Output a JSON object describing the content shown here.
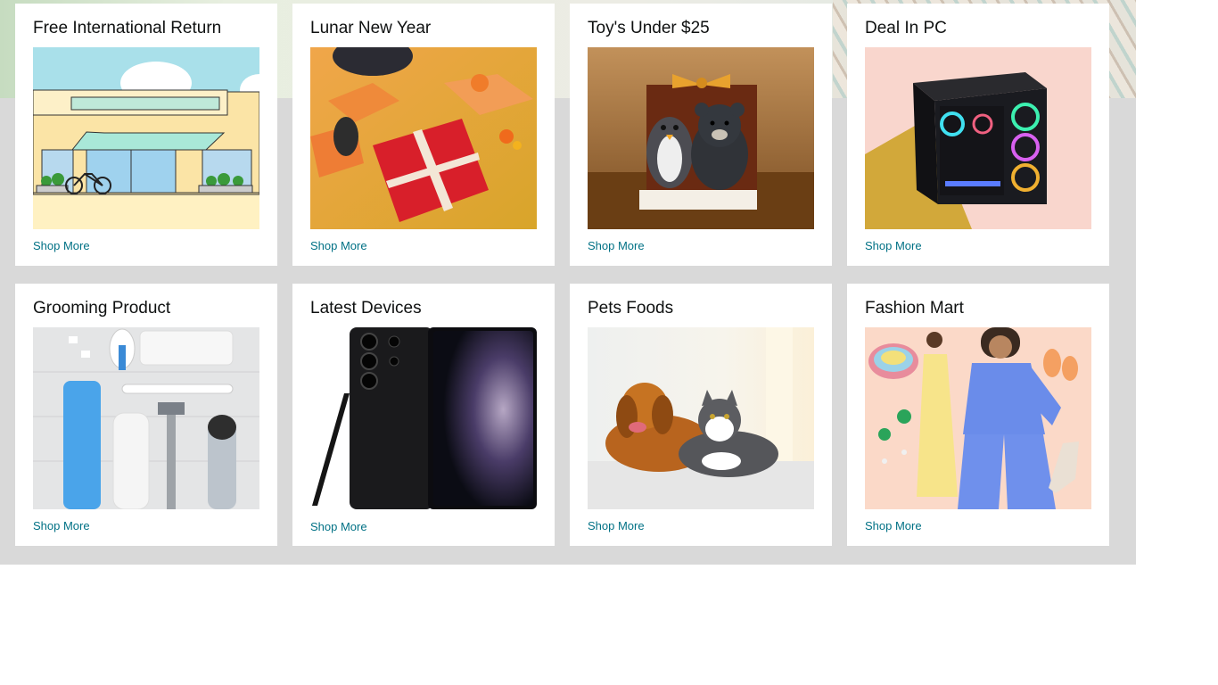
{
  "cards": [
    {
      "title": "Free International Return",
      "link": "Shop More"
    },
    {
      "title": "Lunar New Year",
      "link": "Shop More"
    },
    {
      "title": "Toy's Under $25",
      "link": "Shop More"
    },
    {
      "title": "Deal In PC",
      "link": "Shop More"
    },
    {
      "title": "Grooming Product",
      "link": "Shop More"
    },
    {
      "title": "Latest Devices",
      "link": "Shop More"
    },
    {
      "title": "Pets Foods",
      "link": "Shop More"
    },
    {
      "title": "Fashion Mart",
      "link": "Shop More"
    }
  ],
  "colors": {
    "link": "#007185",
    "title": "#0f1111",
    "panel": "#d9d9d9",
    "card": "#ffffff"
  }
}
